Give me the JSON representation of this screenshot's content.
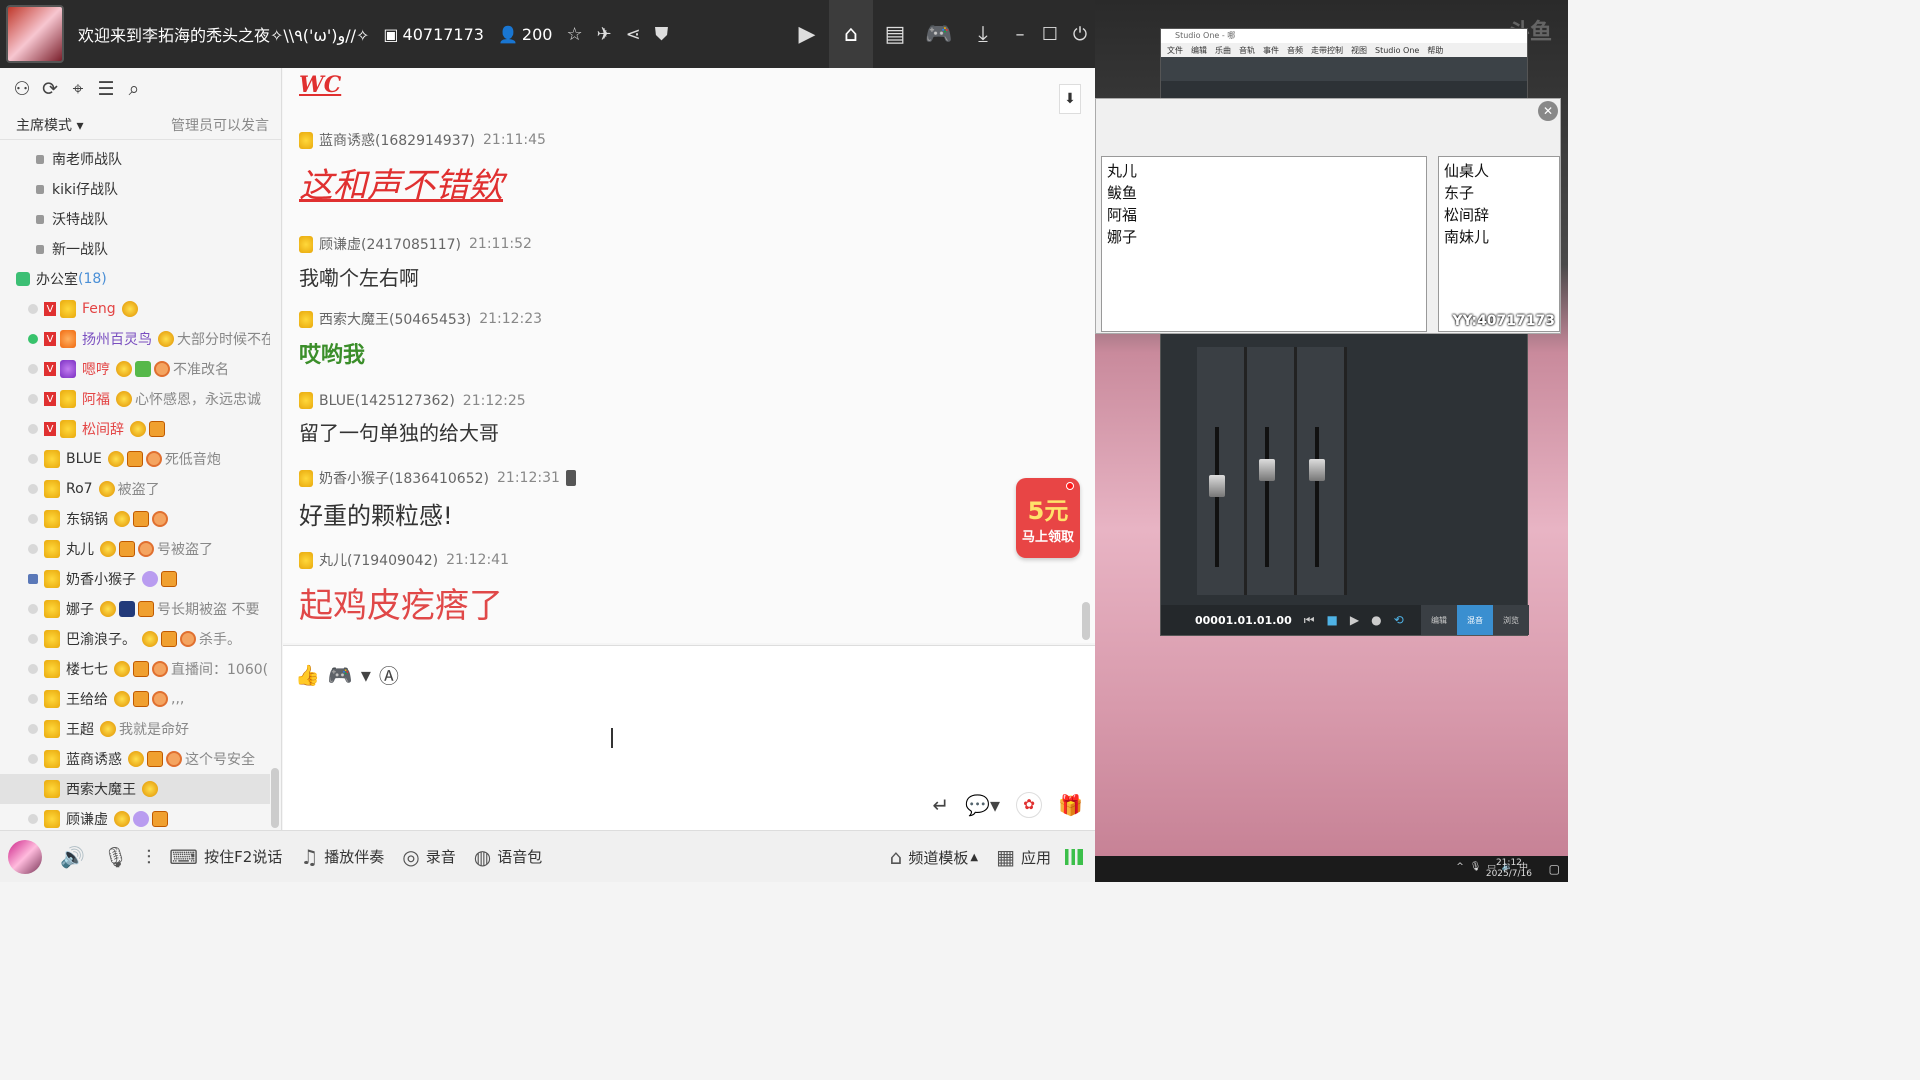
{
  "channel": {
    "title": "欢迎来到李拓海的秃头之夜✧\\\\٩('ω')و//✧",
    "id_number": "40717173",
    "online_count": "200"
  },
  "nav": [
    "video",
    "home",
    "doc",
    "game",
    "download"
  ],
  "sidebar": {
    "mode_label": "主席模式 ▾",
    "mode_note": "管理员可以发言",
    "teams": [
      "南老师战队",
      "kiki仔战队",
      "沃特战队",
      "新一战队"
    ],
    "room": {
      "name": "办公室",
      "count": "(18)"
    },
    "members": [
      {
        "name": "Feng",
        "note": ""
      },
      {
        "name": "扬州百灵鸟",
        "note": "大部分时候不在"
      },
      {
        "name": "嗯哼",
        "note": "不准改名"
      },
      {
        "name": "阿福",
        "note": "心怀感恩，永远忠诚"
      },
      {
        "name": "松间辞",
        "note": ""
      },
      {
        "name": "BLUE",
        "note": "死低音炮"
      },
      {
        "name": "Ro7",
        "note": "被盗了"
      },
      {
        "name": "东锅锅",
        "note": ""
      },
      {
        "name": "丸儿",
        "note": "号被盗了"
      },
      {
        "name": "奶香小猴子",
        "note": ""
      },
      {
        "name": "娜子",
        "note": "号长期被盗 不要"
      },
      {
        "name": "巴渝浪子。",
        "note": "杀手。"
      },
      {
        "name": "楼七七",
        "note": "直播间：1060("
      },
      {
        "name": "王给给",
        "note": ",,,"
      },
      {
        "name": "王超",
        "note": "我就是命好"
      },
      {
        "name": "蓝商诱惑",
        "note": "这个号安全"
      },
      {
        "name": "西索大魔王",
        "note": ""
      },
      {
        "name": "顾谦虚",
        "note": ""
      }
    ]
  },
  "chat": {
    "wc": "WC",
    "messages": [
      {
        "user": "蓝商诱惑(1682914937)",
        "time": "21:11:45",
        "text": "这和声不错欸"
      },
      {
        "user": "顾谦虚(2417085117)",
        "time": "21:11:52",
        "text": "我嘞个左右啊"
      },
      {
        "user": "西索大魔王(50465453)",
        "time": "21:12:23",
        "text": "哎哟我"
      },
      {
        "user": "BLUE(1425127362)",
        "time": "21:12:25",
        "text": "留了一句单独的给大哥"
      },
      {
        "user": "奶香小猴子(1836410652)",
        "time": "21:12:31",
        "text": "好重的颗粒感!"
      },
      {
        "user": "丸儿(719409042)",
        "time": "21:12:41",
        "text": "起鸡皮疙瘩了"
      }
    ],
    "promo_amount": "5元",
    "promo_text": "马上领取"
  },
  "bottombar": {
    "ptt": "按住F2说话",
    "music": "播放伴奏",
    "record": "录音",
    "voicepack": "语音包",
    "template": "频道模板",
    "apps": "应用"
  },
  "desktop": {
    "watermark": "斗鱼",
    "studio_title": "Studio One - 哪",
    "studio_menu": [
      "文件",
      "编辑",
      "乐曲",
      "音轨",
      "事件",
      "音频",
      "走带控制",
      "视图",
      "Studio One",
      "帮助"
    ],
    "timecode": "00001.01.01.00",
    "transport_tabs": [
      "编辑",
      "混音",
      "浏览"
    ],
    "list_left": [
      "丸儿",
      "鲅鱼",
      "阿福",
      "娜子"
    ],
    "list_right": [
      "仙桌人",
      "东子",
      "松间辞",
      "南妹儿"
    ],
    "yy_id": "YY:40717173",
    "clock_time": "21:12",
    "clock_date": "2025/7/16"
  }
}
